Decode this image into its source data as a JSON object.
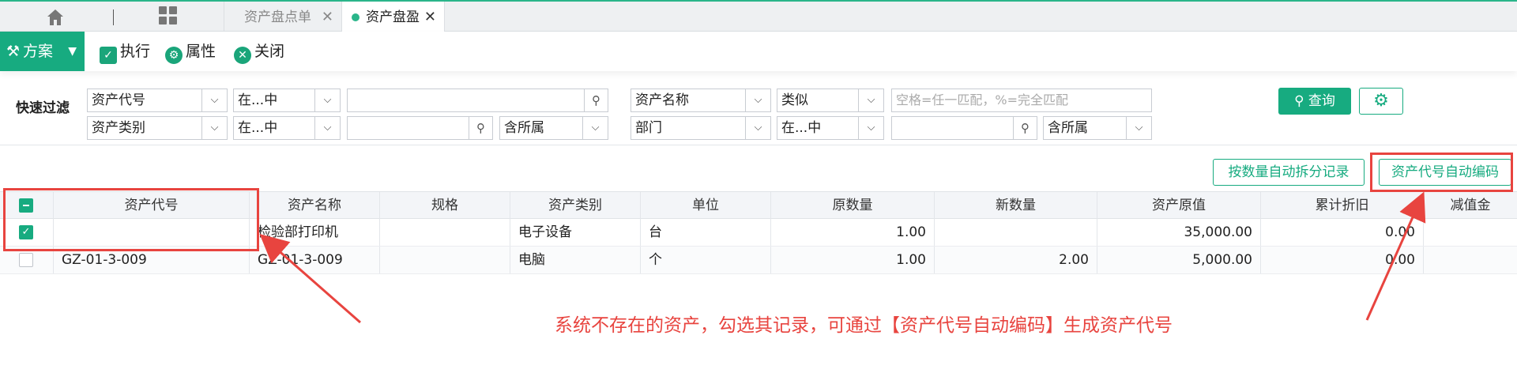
{
  "tabs": {
    "home_icon": "home-icon",
    "grid_icon": "grid-icon",
    "items": [
      {
        "label": "资产盘点单",
        "close": "✕",
        "active": false
      },
      {
        "label": "资产盘盈",
        "close": "✕",
        "active": true
      }
    ]
  },
  "toolbar": {
    "plan_label": "方案",
    "execute_label": "执行",
    "properties_label": "属性",
    "close_label": "关闭"
  },
  "filter": {
    "label": "快速过滤",
    "row1": {
      "field1": "资产代号",
      "op1": "在...中",
      "value1": "",
      "field2": "资产名称",
      "op2": "类似",
      "placeholder2": "空格=任一匹配，%=完全匹配"
    },
    "row2": {
      "field1": "资产类别",
      "op1": "在...中",
      "value1": "",
      "scope1": "含所属",
      "field2": "部门",
      "op2": "在...中",
      "value2": "",
      "scope2": "含所属"
    },
    "query_label": "查询"
  },
  "actions": {
    "split_label": "按数量自动拆分记录",
    "autocode_label": "资产代号自动编码"
  },
  "table": {
    "columns": [
      "资产代号",
      "资产名称",
      "规格",
      "资产类别",
      "单位",
      "原数量",
      "新数量",
      "资产原值",
      "累计折旧",
      "减值金"
    ],
    "rows": [
      {
        "checked": true,
        "code": "",
        "name": "检验部打印机",
        "spec": "",
        "category": "电子设备",
        "unit": "台",
        "orig_qty": "1.00",
        "new_qty": "",
        "orig_value": "35,000.00",
        "depr": "0.00",
        "impair": ""
      },
      {
        "checked": false,
        "code": "GZ-01-3-009",
        "name": "GZ-01-3-009",
        "spec": "",
        "category": "电脑",
        "unit": "个",
        "orig_qty": "1.00",
        "new_qty": "2.00",
        "orig_value": "5,000.00",
        "depr": "0.00",
        "impair": ""
      }
    ]
  },
  "annotation": {
    "text": "系统不存在的资产，勾选其记录，可通过【资产代号自动编码】生成资产代号"
  },
  "colors": {
    "accent": "#17ab80",
    "annotation": "#e8443f"
  }
}
